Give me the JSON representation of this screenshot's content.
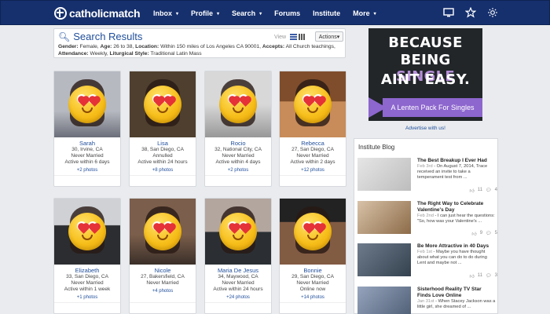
{
  "header": {
    "brand": "catholicmatch",
    "nav": [
      {
        "label": "Inbox",
        "caret": "▾"
      },
      {
        "label": "Profile",
        "caret": "▾"
      },
      {
        "label": "Search",
        "caret": "▾"
      },
      {
        "label": "Forums",
        "caret": ""
      },
      {
        "label": "Institute",
        "caret": ""
      },
      {
        "label": "More",
        "caret": "▾"
      }
    ],
    "icons": [
      "monitor-icon",
      "star-icon",
      "gear-icon"
    ]
  },
  "results": {
    "title": "Search Results",
    "criteria": {
      "gender_label": "Gender:",
      "gender": "Female,",
      "age_label": "Age:",
      "age": "26 to 38,",
      "location_label": "Location:",
      "location": "Within 150 miles of Los Angeles CA 90001,",
      "accepts_label": "Accepts:",
      "accepts": "All Church teachings,",
      "attendance_label": "Attendance:",
      "attendance": "Weekly,",
      "liturgical_label": "Liturgical Style:",
      "liturgical": "Traditional Latin Mass"
    },
    "view_label": "View",
    "actions_label": "Actions▾"
  },
  "cards": [
    {
      "name": "Sarah",
      "line1": "30, Irvine, CA",
      "line2": "Never Married",
      "line3": "Active within 6 days",
      "photos": "+2 photos"
    },
    {
      "name": "Lisa",
      "line1": "38, San Diego, CA",
      "line2": "Annulled",
      "line3": "Active within 24 hours",
      "photos": "+8 photos"
    },
    {
      "name": "Rocio",
      "line1": "32, National City, CA",
      "line2": "Never Married",
      "line3": "Active within 4 days",
      "photos": "+2 photos"
    },
    {
      "name": "Rebecca",
      "line1": "27, San Diego, CA",
      "line2": "Never Married",
      "line3": "Active within 2 days",
      "photos": "+12 photos"
    },
    {
      "name": "Elizabeth",
      "line1": "33, San Diego, CA",
      "line2": "Never Married",
      "line3": "Active within 1 week",
      "photos": "+1 photos"
    },
    {
      "name": "Nicole",
      "line1": "27, Bakersfield, CA",
      "line2": "Never Married",
      "line3": "",
      "photos": "+4 photos"
    },
    {
      "name": "Maria De Jesus",
      "line1": "34, Maywood, CA",
      "line2": "Never Married",
      "line3": "Active within 24 hours",
      "photos": "+24 photos"
    },
    {
      "name": "Bonnie",
      "line1": "29, San Diego, CA",
      "line2": "Never Married",
      "line3": "Online now",
      "photos": "+14 photos"
    }
  ],
  "ad": {
    "line1": "BECAUSE",
    "line2_pre": "BEING ",
    "line2_accent": "SINGLE",
    "line3": "AINT EASY.",
    "band": "A Lenten Pack For Singles",
    "advertise": "Advertise with us!"
  },
  "blog": {
    "title": "Institute Blog",
    "items": [
      {
        "title": "The Best Breakup I Ever Had",
        "date": "Feb 3rd",
        "body": " - On August 7, 2014, Trace received an invite to take a temperament test from ...",
        "likes": "11",
        "comments": "4"
      },
      {
        "title": "The Right Way to Celebrate Valentine's Day",
        "date": "Feb 2nd",
        "body": " - I can just hear the questions: \"So, how was your Valentine's ...",
        "likes": "9",
        "comments": "5"
      },
      {
        "title": "Be More Attractive in 40 Days",
        "date": "Feb 1st",
        "body": " - Maybe you have thought about what you can do to do during Lent and maybe not ...",
        "likes": "11",
        "comments": "3"
      },
      {
        "title": "Sisterhood Reality TV Star Finds Love Online",
        "date": "Jan 31st",
        "body": " - When Stacey Jackson was a little girl, she dreamed of ...",
        "likes": "",
        "comments": ""
      }
    ]
  }
}
